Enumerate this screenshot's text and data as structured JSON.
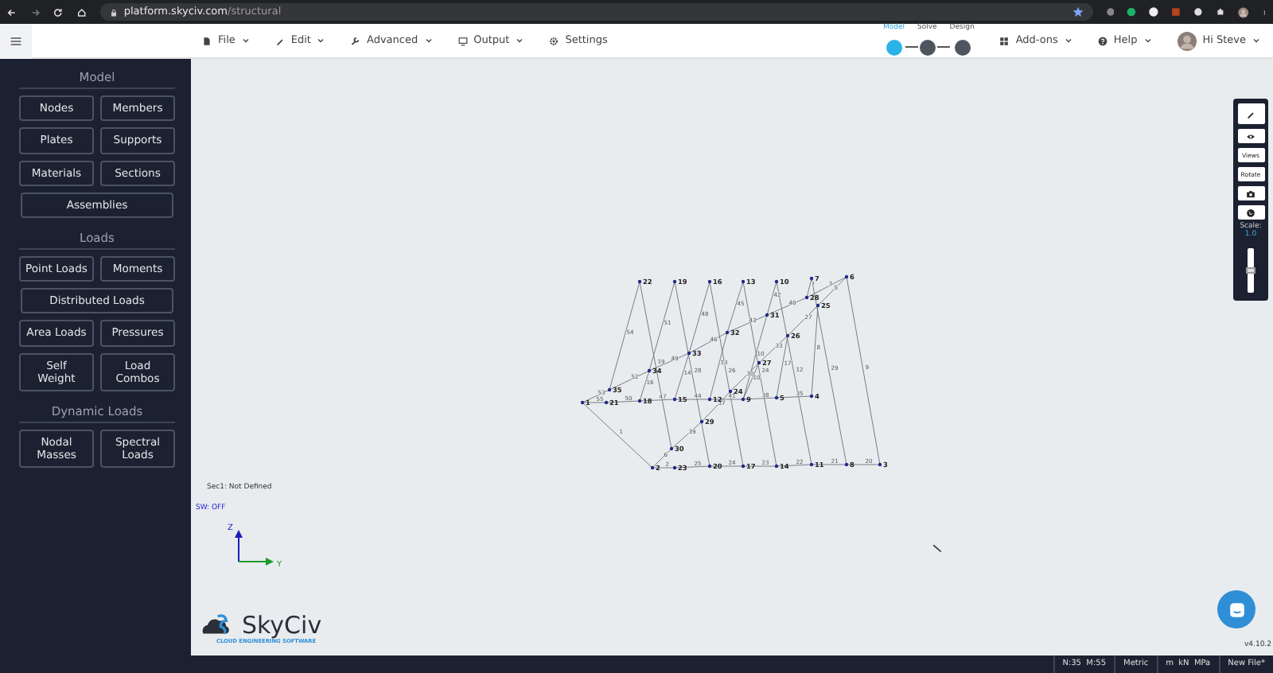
{
  "browser": {
    "url_host": "platform.skyciv.com",
    "url_path": "/structural"
  },
  "menu_bar": {
    "items": [
      {
        "label": "File",
        "kind": "file"
      },
      {
        "label": "Edit",
        "kind": "pencil"
      },
      {
        "label": "Advanced",
        "kind": "wrench"
      },
      {
        "label": "Output",
        "kind": "monitor"
      },
      {
        "label": "Settings",
        "kind": "gear"
      }
    ]
  },
  "workflow": [
    {
      "label": "Model",
      "selected": true
    },
    {
      "label": "Solve",
      "selected": false
    },
    {
      "label": "Design",
      "selected": false
    }
  ],
  "right_menu": {
    "addons": "Add-ons",
    "help": "Help",
    "user": "Hi Steve"
  },
  "sidebar": {
    "sections": [
      {
        "title": "Model",
        "buttons": [
          {
            "label": "Nodes",
            "kind": "half"
          },
          {
            "label": "Members",
            "kind": "half"
          },
          {
            "label": "Plates",
            "kind": "half"
          },
          {
            "label": "Supports",
            "kind": "half"
          },
          {
            "label": "Materials",
            "kind": "half"
          },
          {
            "label": "Sections",
            "kind": "half"
          },
          {
            "label": "Assemblies",
            "kind": "wide"
          }
        ]
      },
      {
        "title": "Loads",
        "buttons": [
          {
            "label": "Point Loads",
            "kind": "half"
          },
          {
            "label": "Moments",
            "kind": "half"
          },
          {
            "label": "Distributed Loads",
            "kind": "wide"
          },
          {
            "label": "Area Loads",
            "kind": "half"
          },
          {
            "label": "Pressures",
            "kind": "half"
          },
          {
            "label": "Self\nWeight",
            "kind": "half"
          },
          {
            "label": "Load\nCombos",
            "kind": "half"
          }
        ]
      },
      {
        "title": "Dynamic Loads",
        "buttons": [
          {
            "label": "Nodal\nMasses",
            "kind": "half"
          },
          {
            "label": "Spectral\nLoads",
            "kind": "half"
          }
        ]
      }
    ]
  },
  "canvas": {
    "section_label": "Sec1: Not Defined",
    "self_weight": "SW: OFF",
    "axes": {
      "z": "Z",
      "y": "Y"
    },
    "nodes": [
      "22",
      "19",
      "16",
      "13",
      "10",
      "7",
      "6",
      "28",
      "25",
      "31",
      "32",
      "26",
      "33",
      "27",
      "34",
      "35",
      "1",
      "21",
      "18",
      "15",
      "12",
      "24",
      "9",
      "5",
      "4",
      "29",
      "30",
      "2",
      "23",
      "20",
      "17",
      "14",
      "11",
      "8",
      "3"
    ],
    "members": [
      "1",
      "2",
      "3",
      "6",
      "8",
      "9",
      "10",
      "13",
      "14",
      "16",
      "25",
      "24",
      "23",
      "22",
      "21",
      "20",
      "28",
      "26",
      "24",
      "29",
      "30",
      "33",
      "27",
      "10",
      "39",
      "37",
      "12",
      "54",
      "19",
      "51",
      "48",
      "45",
      "42",
      "7",
      "5",
      "53",
      "52",
      "49",
      "46",
      "43",
      "40",
      "55",
      "50",
      "47",
      "44",
      "41",
      "38",
      "35",
      "17"
    ]
  },
  "toolbar": {
    "buttons": [
      {
        "kind": "pencil"
      },
      {
        "kind": "eye"
      },
      {
        "kind": "text",
        "label": "Views"
      },
      {
        "kind": "text",
        "label": "Rotate"
      },
      {
        "kind": "camera"
      },
      {
        "kind": "globe"
      }
    ],
    "scale_label": "Scale:",
    "scale_value": "1.0",
    "slider": {
      "level": 0.5
    }
  },
  "logo": {
    "name": "SkyCiv",
    "tagline": "CLOUD ENGINEERING SOFTWARE"
  },
  "version": "v4.10.2",
  "status_bar": [
    "N:35  M:55",
    "Metric",
    "m  kN  MPa",
    "New File*"
  ]
}
